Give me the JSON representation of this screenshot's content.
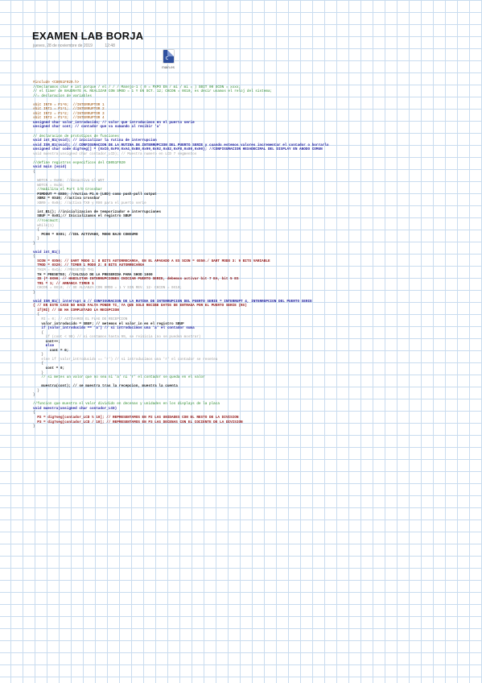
{
  "header": {
    "title": "EXAMEN LAB BORJA",
    "date": "jueves, 28 de noviembre de 2019",
    "time": "12:48"
  },
  "attachment": {
    "name": "main.es",
    "icon": "file-icon"
  },
  "code_lines": [
    {
      "t": "#include <C8051F020.h>",
      "s": "m"
    },
    {
      "t": "//Declaramos char e int porque / el / / / Manejo-1 ( 0 = PXPO EN / mi / mi = ) SBIT 00 SCON = xxxx;",
      "s": "c"
    },
    {
      "t": "// el timer de BAUDRATE AL REALIZAR CON SMOD = 1 Y EN SCT. 12; CKCON = 0X10, es decir usamos el reloj del sistema;",
      "s": "c"
    },
    {
      "t": "//= declaracion de variables",
      "s": "c"
    },
    {
      "t": "",
      "s": ""
    },
    {
      "t": "sbit INT0 = P1^0;  //INTERRUPTOR 1",
      "s": "m"
    },
    {
      "t": "sbit INT1 = P1^1;  //INTERRUPTOR 2",
      "s": "m"
    },
    {
      "t": "sbit INT2 = P1^2;  //INTERRUPTOR 3",
      "s": "m"
    },
    {
      "t": "sbit INT3 = P1^3;  //INTERRUPTOR 4",
      "s": "m"
    },
    {
      "t": "unsigned char valor_introducido; // valor que introducimos en el puerto serie",
      "s": "k"
    },
    {
      "t": "unsigned char cont; // contador que va sumando al recibir 'a'",
      "s": "k"
    },
    {
      "t": "",
      "s": ""
    },
    {
      "t": "// declaracion de prototipos de funciones",
      "s": "c"
    },
    {
      "t": "void int_B1(void); // inicializar la rutina de interrupcion",
      "s": "k"
    },
    {
      "t": "void ISR_B1(void); // CONFIGURACION DE LA RUTINA DE INTERRUPCION DEL PUERTO SERIE y cuando estemos valores incrementar el contador o borrarlo",
      "s": "k"
    },
    {
      "t": "unsigned char code dig7seg[] = {0xC0,0xF9,0xA4,0xB0,0x99,0x92,0x82,0xF8,0x80,0x90}; //CONFIGURACION HEXADECIMAL DEL DISPLAY EN ANODO COMUN",
      "s": "k"
    },
    {
      "t": "void muestra(unsigned char contador_LCD); // Muestra numero en LCD 7 segmentos",
      "s": "g"
    },
    {
      "t": "",
      "s": ""
    },
    {
      "t": "//define registros especificos del C8051F020",
      "s": "c"
    },
    {
      "t": "void main (void)",
      "s": "k"
    },
    {
      "t": "{",
      "s": ""
    },
    {
      "t": "",
      "s": ""
    },
    {
      "t": "  WDTCN = 0xDE; //desactiva el WDT",
      "s": "g"
    },
    {
      "t": "  WDTCN = 0xAD;",
      "s": "g"
    },
    {
      "t": "  //Habilita el Port I/O Crossbar",
      "s": "c"
    },
    {
      "t": "  P3MDOUT = 0XE0; //Activa P1.6 (LED) como push-pull output",
      "s": "b"
    },
    {
      "t": "  XBR2 = 0X40; //activa crossbar",
      "s": "b"
    },
    {
      "t": "  XBR0 = 0x04; //activa TX0 y RX0 para el puerto serie",
      "s": "g"
    },
    {
      "t": "",
      "s": ""
    },
    {
      "t": "  int_B1(); //inicializacion de temporizador e interrupciones",
      "s": "b"
    },
    {
      "t": "  SBUF = 0x01;// Inicializamos el registro SBUF",
      "s": "b"
    },
    {
      "t": "  //roscmuzt;",
      "s": "c"
    },
    {
      "t": "  while(1)",
      "s": "g"
    },
    {
      "t": "  {",
      "s": ""
    },
    {
      "t": "    PCON = 0X01; //IDL ACTIVADO, MODO BAJO CONSUMO",
      "s": "b"
    },
    {
      "t": "  }",
      "s": ""
    },
    {
      "t": "}",
      "s": ""
    },
    {
      "t": "",
      "s": ""
    },
    {
      "t": "void int_B1()",
      "s": "k"
    },
    {
      "t": "{",
      "s": ""
    },
    {
      "t": "  SCON = 0X50; // UART MODO 1: 8 BITS AUTORRECARGA, EN EL APAGADO A ES SCON = 0X50./ UART MODO 3: 9 BITS VARIABLE",
      "s": "d"
    },
    {
      "t": "  TMOD = 0X20; // TIMER 1 MODO 2: 8 BITS AUTORRECARGA",
      "s": "d"
    },
    {
      "t": "  TH1M = 0xCA; //PRESETEO TH1",
      "s": "g"
    },
    {
      "t": "  TH = PRESETEO; //CALCULO DE LA PRESERIDA PARA SHOD 1000",
      "s": "b"
    },
    {
      "t": "  IE |= 0X90; // HABILITAR INTERRUPCIONES INICIAR PUERTO SERIE, debemos activar bit 7 EA, bit 5 ES",
      "s": "d"
    },
    {
      "t": "  TR1 = 1; // ARRANCA TIMER 1",
      "s": "d"
    },
    {
      "t": "  CKCON = 0X10; // SE ALCANZA CON SMOD = 1 Y SIN REV. 12- CKCON = 0X10;",
      "s": "g"
    },
    {
      "t": "}",
      "s": ""
    },
    {
      "t": "",
      "s": ""
    },
    {
      "t": "void ISR_B1() interrupt 4 // CONFIGURACION DE LA RUTINA DE INTERRUPCION DEL PUERTO SERIE = INTERRUPT 4, INTERRUPCION DEL PUERTO SERIE",
      "s": "k"
    },
    {
      "t": "{ // EN ESTE CASO NO HACE FALTA PONER TI, YA QUE SOLO RECIBE DATOS DE ENTRADA POR EL PUERTO SERIE (RX)",
      "s": "d"
    },
    {
      "t": "  if(RI) // SE HA COMPLETADO LA RECEPCION",
      "s": "d"
    },
    {
      "t": "  {",
      "s": ""
    },
    {
      "t": "    RI = 0; // ACTIVAMOS EL FLAG DE RECEPCION",
      "s": "g"
    },
    {
      "t": "    valor_introducido = SBUF; // metemos el valor_in en el registro SBUF",
      "s": "b"
    },
    {
      "t": "    if (valor_introducido == 'a') // si introducimos una 'a' el contador suma",
      "s": "k"
    },
    {
      "t": "    {",
      "s": ""
    },
    {
      "t": "      if (cont < 99) // si contamos hasta 99, se reinicia (no se pueden mostrar)",
      "s": "g"
    },
    {
      "t": "      cont++;",
      "s": "b"
    },
    {
      "t": "      else",
      "s": "k"
    },
    {
      "t": "        cont = 0;",
      "s": "b"
    },
    {
      "t": "    }",
      "s": ""
    },
    {
      "t": "    else if (valor_introducido == 'r') // si introducimos una 'r' el contador se resetea",
      "s": "g"
    },
    {
      "t": "    {",
      "s": ""
    },
    {
      "t": "      cont = 0;",
      "s": "b"
    },
    {
      "t": "    }",
      "s": ""
    },
    {
      "t": "    // si metes un valor que no sea ni 'a' ni 'r' el contador se queda en el valor",
      "s": "c"
    },
    {
      "t": "",
      "s": ""
    },
    {
      "t": "    muestra(cont); // se muestra tras la recepcion, muestra la cuenta",
      "s": "b"
    },
    {
      "t": "  }",
      "s": ""
    },
    {
      "t": "}",
      "s": ""
    },
    {
      "t": "",
      "s": ""
    },
    {
      "t": "//funcion que muestra el valor dividido en decenas y unidades en los displays de la placa",
      "s": "c"
    },
    {
      "t": "void muestra(unsigned char contador_LCD)",
      "s": "k"
    },
    {
      "t": "{",
      "s": ""
    },
    {
      "t": "  P2 = dig7seg[contador_LCD % 10]; // REPRESENTAMOS EN P2 LAS UNIDADES CON EL RESTO DE LA DIVISION",
      "s": "d"
    },
    {
      "t": "  P3 = dig7seg[contador_LCD / 10]; // REPRESENTAMOS EN P3 LAS DECENAS CON EL COCIENTE DE LA DIVISION",
      "s": "d"
    },
    {
      "t": "}",
      "s": ""
    }
  ]
}
